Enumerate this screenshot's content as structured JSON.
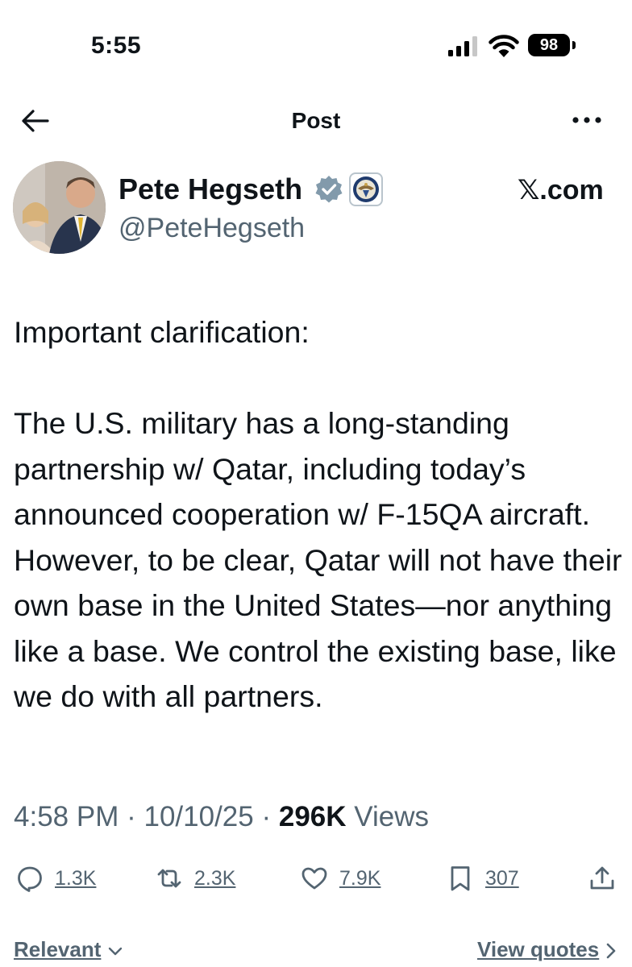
{
  "status_bar": {
    "time": "5:55",
    "battery": "98",
    "icons": [
      "cellular-signal-icon",
      "wifi-icon",
      "battery-icon"
    ]
  },
  "header": {
    "title": "Post",
    "icons": [
      "back-arrow-icon",
      "more-options-icon"
    ]
  },
  "author": {
    "name": "Pete Hegseth",
    "handle": "@PeteHegseth",
    "badges": [
      "verified-badge-icon",
      "department-of-defense-seal-icon"
    ]
  },
  "watermark": {
    "site": "𝕏.com"
  },
  "post": {
    "paragraphs": [
      "Important clarification:",
      "The U.S. military has a long-standing partnership w/ Qatar, including today’s announced cooperation w/ F-15QA aircraft. However, to be clear, Qatar will not have their own base in the United States—nor anything like a base. We control the existing base, like we do with all partners."
    ]
  },
  "meta": {
    "time": "4:58 PM",
    "separator": "·",
    "date": "10/10/25",
    "views_count": "296K",
    "views_label": "Views"
  },
  "actions": {
    "replies": "1.3K",
    "reposts": "2.3K",
    "likes": "7.9K",
    "bookmarks": "307"
  },
  "footer": {
    "sort_label": "Relevant",
    "quotes_label": "View quotes"
  },
  "colors": {
    "text": "#0f1419",
    "secondary": "#536471",
    "verified": "#829aab"
  }
}
